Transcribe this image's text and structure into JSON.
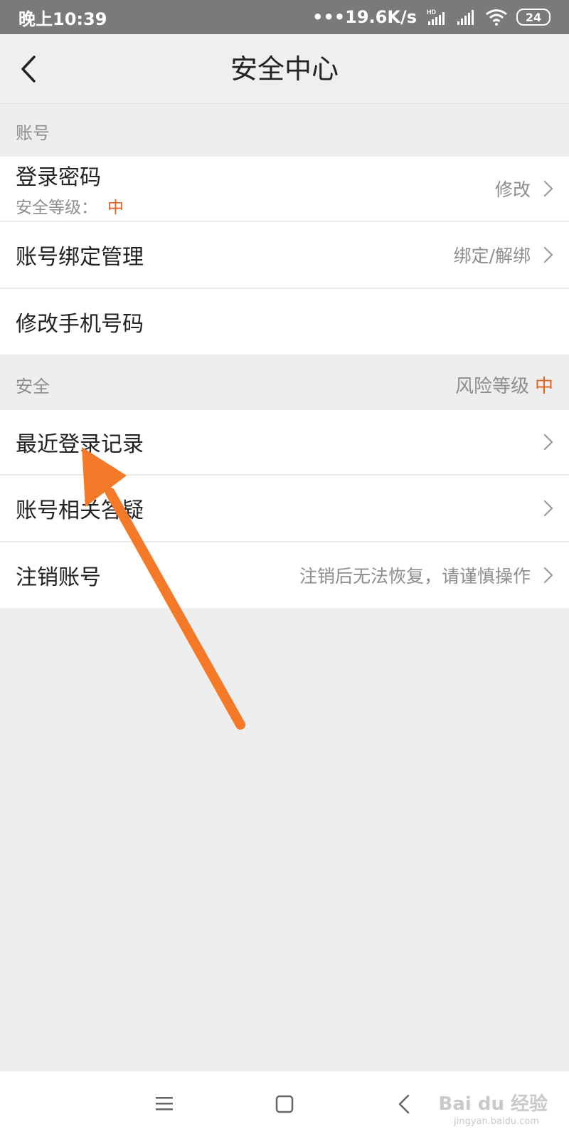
{
  "status_bar": {
    "time": "晚上10:39",
    "network_speed": "•••19.6K/s",
    "hd_label": "HD",
    "battery": "24"
  },
  "header": {
    "title": "安全中心",
    "back_icon": "chevron-left-icon"
  },
  "account_section": {
    "title": "账号",
    "rows": [
      {
        "label": "登录密码",
        "sub_label": "安全等级：",
        "sub_level": "中",
        "action": "修改"
      },
      {
        "label": "账号绑定管理",
        "action": "绑定/解绑"
      },
      {
        "label": "修改手机号码"
      }
    ]
  },
  "security_section": {
    "title": "安全",
    "risk_label": "风险等级",
    "risk_level": "中",
    "rows": [
      {
        "label": "最近登录记录"
      },
      {
        "label": "账号相关答疑"
      },
      {
        "label": "注销账号",
        "action": "注销后无法恢复，请谨慎操作"
      }
    ]
  },
  "nav_bar": {
    "menu_icon": "menu-icon",
    "home_icon": "home-square-icon",
    "back_icon": "back-triangle-icon"
  },
  "watermark": {
    "text": "Bai du 经验",
    "sub": "jingyan.baidu.com"
  },
  "colors": {
    "accent": "#e2641f",
    "arrow": "#f47a2a",
    "background": "#efeeee",
    "status_bar": "#7a7a7a"
  }
}
